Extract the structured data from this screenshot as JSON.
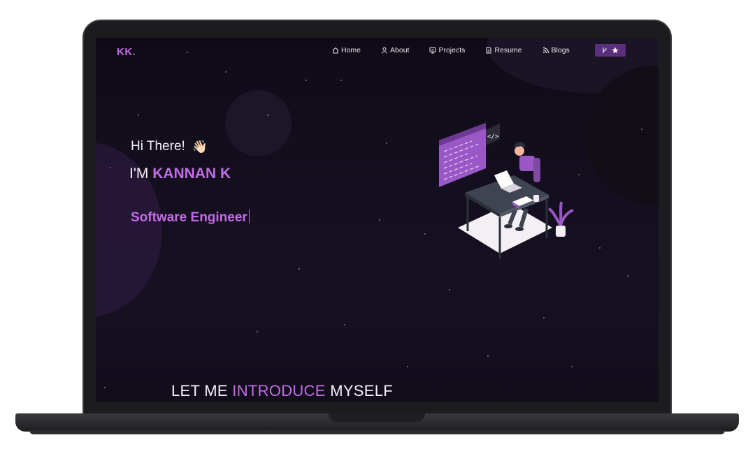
{
  "brand": {
    "logo": "KK.",
    "accent": "#c36be6"
  },
  "nav": {
    "items": [
      {
        "label": "Home",
        "icon": "home-icon"
      },
      {
        "label": "About",
        "icon": "user-icon"
      },
      {
        "label": "Projects",
        "icon": "projects-icon"
      },
      {
        "label": "Resume",
        "icon": "document-icon"
      },
      {
        "label": "Blogs",
        "icon": "rss-icon"
      }
    ],
    "github_button": {
      "icons": [
        "git-fork-icon",
        "star-icon"
      ]
    }
  },
  "hero": {
    "greeting": "Hi There!",
    "greeting_emoji": "👋🏻",
    "name_prefix": "I'M",
    "name": "KANNAN K",
    "role": "Software Engineer"
  },
  "intro": {
    "part1": "LET ME",
    "part2": "INTRODUCE",
    "part3": "MYSELF"
  }
}
